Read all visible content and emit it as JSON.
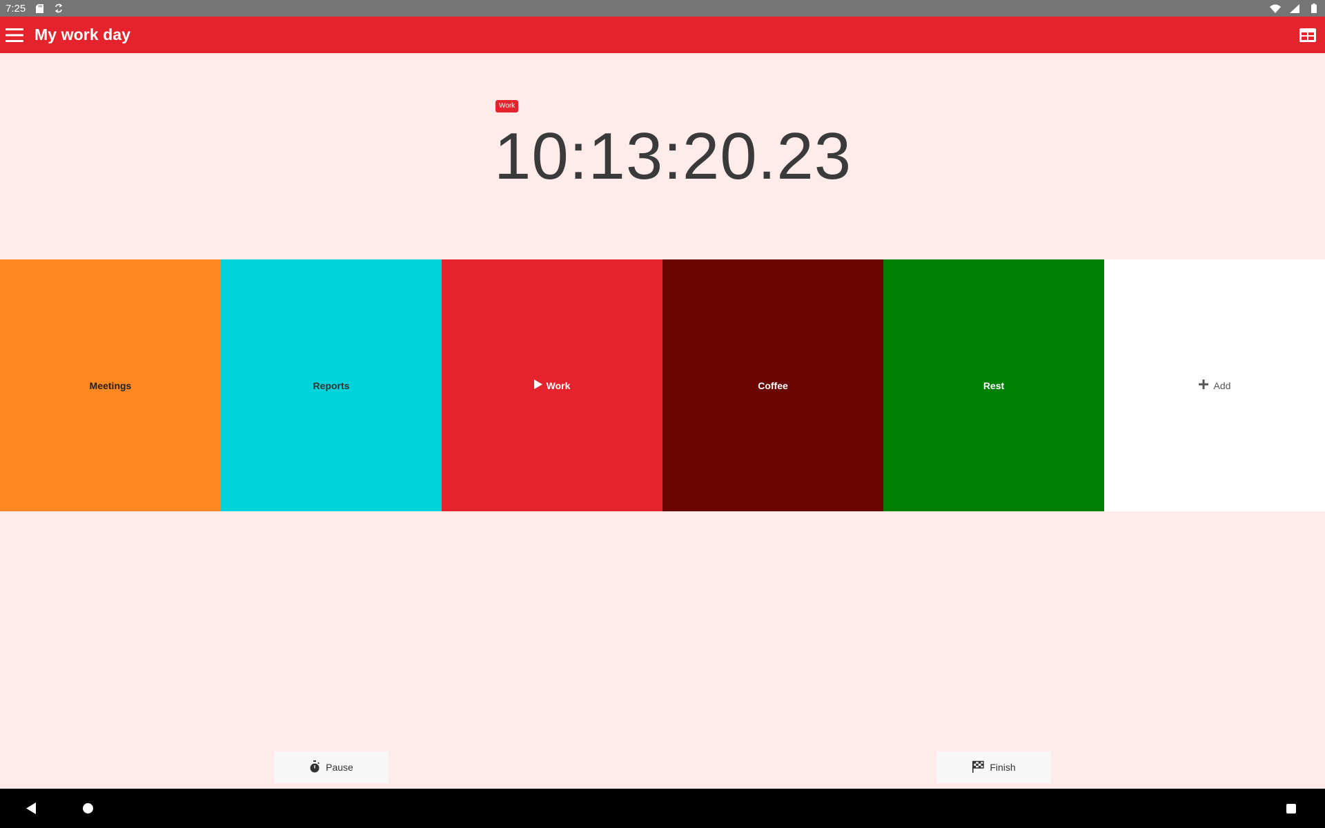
{
  "status_bar": {
    "time": "7:25",
    "left_icons": [
      "sd-card-icon",
      "sync-icon"
    ],
    "right_icons": [
      "wifi-icon",
      "cell-signal-icon",
      "battery-icon"
    ]
  },
  "app_bar": {
    "title": "My work day",
    "menu_icon": "hamburger-menu-icon",
    "layout_icon": "table-layout-icon",
    "color": "#e5232c"
  },
  "timer": {
    "current_activity_badge": "Work",
    "elapsed": "10:13:20.23"
  },
  "activities": [
    {
      "label": "Meetings",
      "color": "#fd8721",
      "text_color": "#222222",
      "active": false
    },
    {
      "label": "Reports",
      "color": "#00d4db",
      "text_color": "#333333",
      "active": false
    },
    {
      "label": "Work",
      "color": "#e5232c",
      "text_color": "#ffffff",
      "active": true
    },
    {
      "label": "Coffee",
      "color": "#6b0703",
      "text_color": "#ffffff",
      "active": false
    },
    {
      "label": "Rest",
      "color": "#008000",
      "text_color": "#ffffff",
      "active": false
    }
  ],
  "add_tile": {
    "label": "Add",
    "icon": "plus-icon",
    "color": "#ffffff"
  },
  "controls": {
    "pause_label": "Pause",
    "pause_icon": "stopwatch-icon",
    "finish_label": "Finish",
    "finish_icon": "checkered-flag-icon"
  },
  "nav_bar": {
    "icons": [
      "back-icon",
      "home-icon",
      "recents-icon"
    ]
  }
}
